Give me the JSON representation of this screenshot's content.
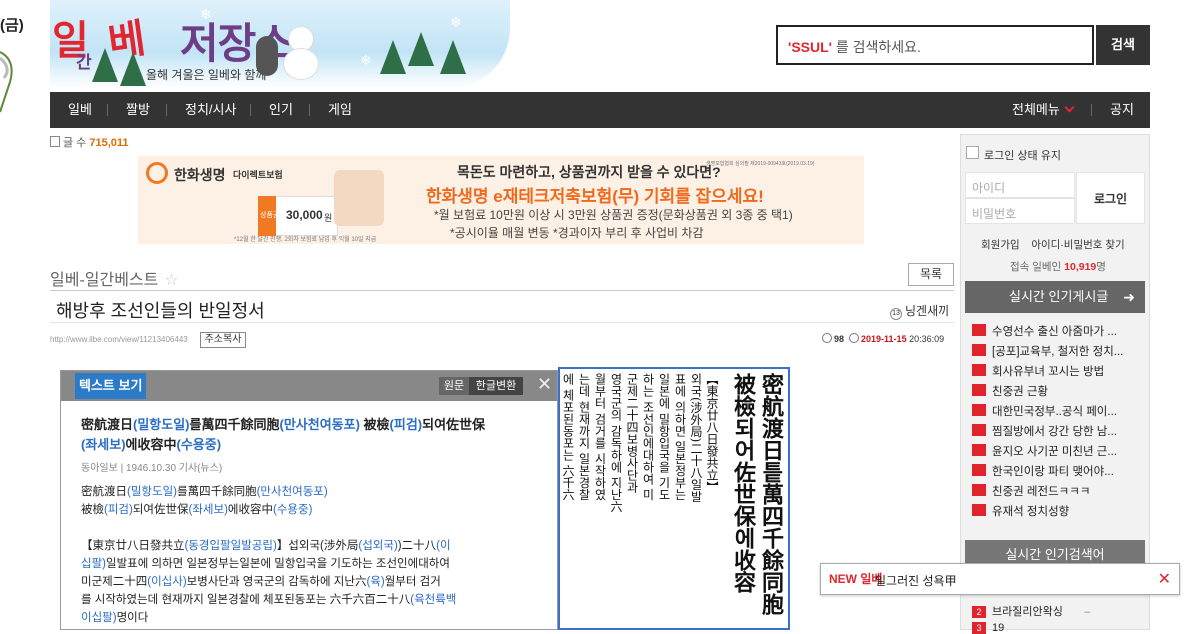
{
  "edge": {
    "label": "(금)"
  },
  "logo": {
    "part1": "일",
    "part2": "간",
    "part3": "베",
    "part4": "저장소",
    "tagline": "올해 겨울은 일베와 함께"
  },
  "search": {
    "keyword": "'SSUL'",
    "placeholder": " 를 검색하세요.",
    "button": "검색"
  },
  "nav": {
    "items": [
      "일베",
      "짤방",
      "정치/시사",
      "인기",
      "게임"
    ],
    "menu": "전체메뉴",
    "notice": "공지"
  },
  "post_count": {
    "label": "글 수",
    "value": "715,011"
  },
  "banner": {
    "brand": "한화생명",
    "brand_sub": "다이렉트보험",
    "card_label": "상품권",
    "card_value": "30,000",
    "card_unit": "원",
    "line1": "목돈도 마련하고, 상품권까지 받을 수 있다면?",
    "line2": "한화생명 e재테크저축보험(무) 기회를 잡으세요!",
    "line3": "*월 보험료 10만원 이상 시 3만원 상품권 증정(문화상품권 외 3종 중 택1)",
    "line4": "*공시이율 매월 변동 *경과이자 부리 후 사업비 차감",
    "fine_top": "생명보험협회 심의필 제2019-00943호(2019.03.19)",
    "fine_bottom": "*12월 한 달간 진행, 2회차 보험료 납입 후 익월 10일 지급"
  },
  "board": {
    "name": "일베-일간베스트",
    "list_button": "목록"
  },
  "post": {
    "title": "해방후 조선인들의 반일정서",
    "level": "13",
    "author": "닝겐새끼",
    "url": "http://www.ilbe.com/view/11213406443",
    "url_button": "주소복사",
    "comments": "98",
    "date": "2019-11-15",
    "time": "20:36:09"
  },
  "panel": {
    "tab": "텍스트 보기",
    "toggle_original": "원문",
    "toggle_convert": "한글변환",
    "title_a": "密航渡日",
    "title_a_hg": "(밀항도일)",
    "title_b": "를萬四千餘同胞",
    "title_b_hg": "(만사천여동포)",
    "title_c": " 被檢",
    "title_c_hg": "(피검)",
    "title_d": "되여佐世保",
    "title_d_hg": "(좌세보)",
    "title_e": "에收容中",
    "title_e_hg": "(수용중)",
    "source": "동아일보 | 1946.10.30 기사(뉴스)",
    "body1_a": "密航渡日",
    "body1_a_hg": "(밀항도일)",
    "body1_b": "를萬四千餘同胞",
    "body1_b_hg": "(만사천여동포)",
    "body2_a": "被檢",
    "body2_a_hg": "(피검)",
    "body2_b": "되여佐世保",
    "body2_b_hg": "(좌세보)",
    "body2_c": "에收容中",
    "body2_c_hg": "(수용중)",
    "body3_a": "【東京廿八日發共立",
    "body3_a_hg": "(동경입팔일발공립)",
    "body3_b": "】섭외국(涉外局",
    "body3_b_hg": "(섭외국)",
    "body3_c": ")二十八",
    "body3_c_hg": "(이",
    "body4_a_hg": "십팔)",
    "body4_b": "일발표에 의하면 일본정부는일본에 밀항입국을 기도하는 조선인에대하여",
    "body5": " 미군제二十四",
    "body5_hg": "(이십사)",
    "body5_b": "보병사단과 영국군의 감독하에 지난六",
    "body5_hg2": "(육)",
    "body5_c": "월부터 검거",
    "body6": "를 시작하였는데 현재까지 일본경찰에 체포된동포는 六千六百二十八",
    "body6_hg": "(육천륙백",
    "body7_hg": "이십팔)",
    "body7": "명이다"
  },
  "newspaper": {
    "headline1": "密航渡日틑萬四千餘同胞",
    "headline2": "被檢되어佐世保에收容",
    "cols": [
      "【東京廿八日發共立】",
      "외국(涉外局)二十八일발",
      "표에 의하면 일본정부는",
      "일본에 밀항입국을 기도",
      "하는 조선인에대하여 미",
      "군제二十四보병사단과",
      "영국군의 감독하에 지난六",
      "월부터 검거를 시작하였",
      "는데 현재까지 일본경찰",
      "에 체포된동포는 六千六"
    ]
  },
  "sidebar": {
    "keep_login": "로그인 상태 유지",
    "id_placeholder": "아이디",
    "pw_placeholder": "비밀번호",
    "login_button": "로그인",
    "join": "회원가입",
    "find": "아이디·비밀번호 찾기",
    "online_label": "접속 일베인",
    "online_count": "10,919",
    "online_unit": "명",
    "hot_title": "실시간 인기게시글",
    "hot_items": [
      "수영선수 출신 아줌마가 ...",
      "[공포]교육부, 철저한 정치...",
      "회사유부녀 꼬시는 방법",
      "친중권 근황",
      "대한민국정부..공식 페이...",
      "찜질방에서 강간 당한 남...",
      "윤지오 사기꾼 미친년 근...",
      "한국인이랑 파티 맺어야...",
      "친중권 레전드ㅋㅋㅋ",
      "유재석 정치성향"
    ],
    "search_title": "실시간 인기검색어",
    "ranks": [
      {
        "n": "2",
        "text": "브라질리안왁싱",
        "delta": "–"
      },
      {
        "n": "3",
        "text": "19",
        "delta": ""
      }
    ]
  },
  "toast": {
    "badge": "NEW 일베",
    "text": "일그러진 성욕甲"
  }
}
